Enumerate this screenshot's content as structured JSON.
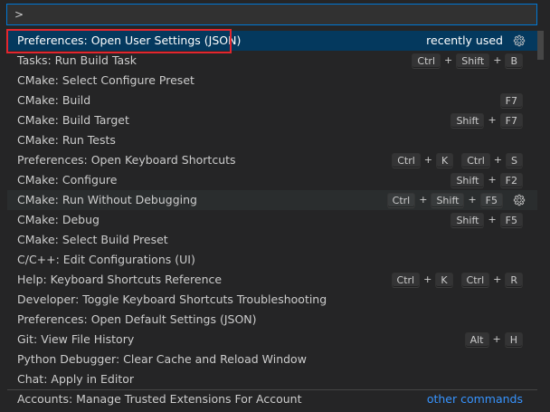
{
  "input": {
    "value": ">"
  },
  "commands": [
    {
      "label": "Preferences: Open User Settings (JSON)",
      "keys": [],
      "recent": "recently used",
      "gear": true,
      "state": "selected"
    },
    {
      "label": "Tasks: Run Build Task",
      "keys": [
        [
          "Ctrl",
          "Shift",
          "B"
        ]
      ]
    },
    {
      "label": "CMake: Select Configure Preset",
      "keys": []
    },
    {
      "label": "CMake: Build",
      "keys": [
        [
          "F7"
        ]
      ]
    },
    {
      "label": "CMake: Build Target",
      "keys": [
        [
          "Shift",
          "F7"
        ]
      ]
    },
    {
      "label": "CMake: Run Tests",
      "keys": []
    },
    {
      "label": "Preferences: Open Keyboard Shortcuts",
      "keys": [
        [
          "Ctrl",
          "K"
        ],
        [
          "Ctrl",
          "S"
        ]
      ]
    },
    {
      "label": "CMake: Configure",
      "keys": [
        [
          "Shift",
          "F2"
        ]
      ]
    },
    {
      "label": "CMake: Run Without Debugging",
      "keys": [
        [
          "Ctrl",
          "Shift",
          "F5"
        ]
      ],
      "gear": true,
      "state": "hovered"
    },
    {
      "label": "CMake: Debug",
      "keys": [
        [
          "Shift",
          "F5"
        ]
      ]
    },
    {
      "label": "CMake: Select Build Preset",
      "keys": []
    },
    {
      "label": "C/C++: Edit Configurations (UI)",
      "keys": []
    },
    {
      "label": "Help: Keyboard Shortcuts Reference",
      "keys": [
        [
          "Ctrl",
          "K"
        ],
        [
          "Ctrl",
          "R"
        ]
      ]
    },
    {
      "label": "Developer: Toggle Keyboard Shortcuts Troubleshooting",
      "keys": []
    },
    {
      "label": "Preferences: Open Default Settings (JSON)",
      "keys": []
    },
    {
      "label": "Git: View File History",
      "keys": [
        [
          "Alt",
          "H"
        ]
      ]
    },
    {
      "label": "Python Debugger: Clear Cache and Reload Window",
      "keys": []
    },
    {
      "label": "Chat: Apply in Editor",
      "keys": []
    },
    {
      "label": "Accounts: Manage Trusted Extensions For Account",
      "keys": [],
      "other": "other commands"
    }
  ],
  "icons": {
    "gear": "gear-icon"
  },
  "colors": {
    "background": "#252526",
    "selected_row": "#04395e",
    "focus_border": "#0078d4",
    "highlight_box": "#e3262e",
    "link": "#3794ff"
  }
}
